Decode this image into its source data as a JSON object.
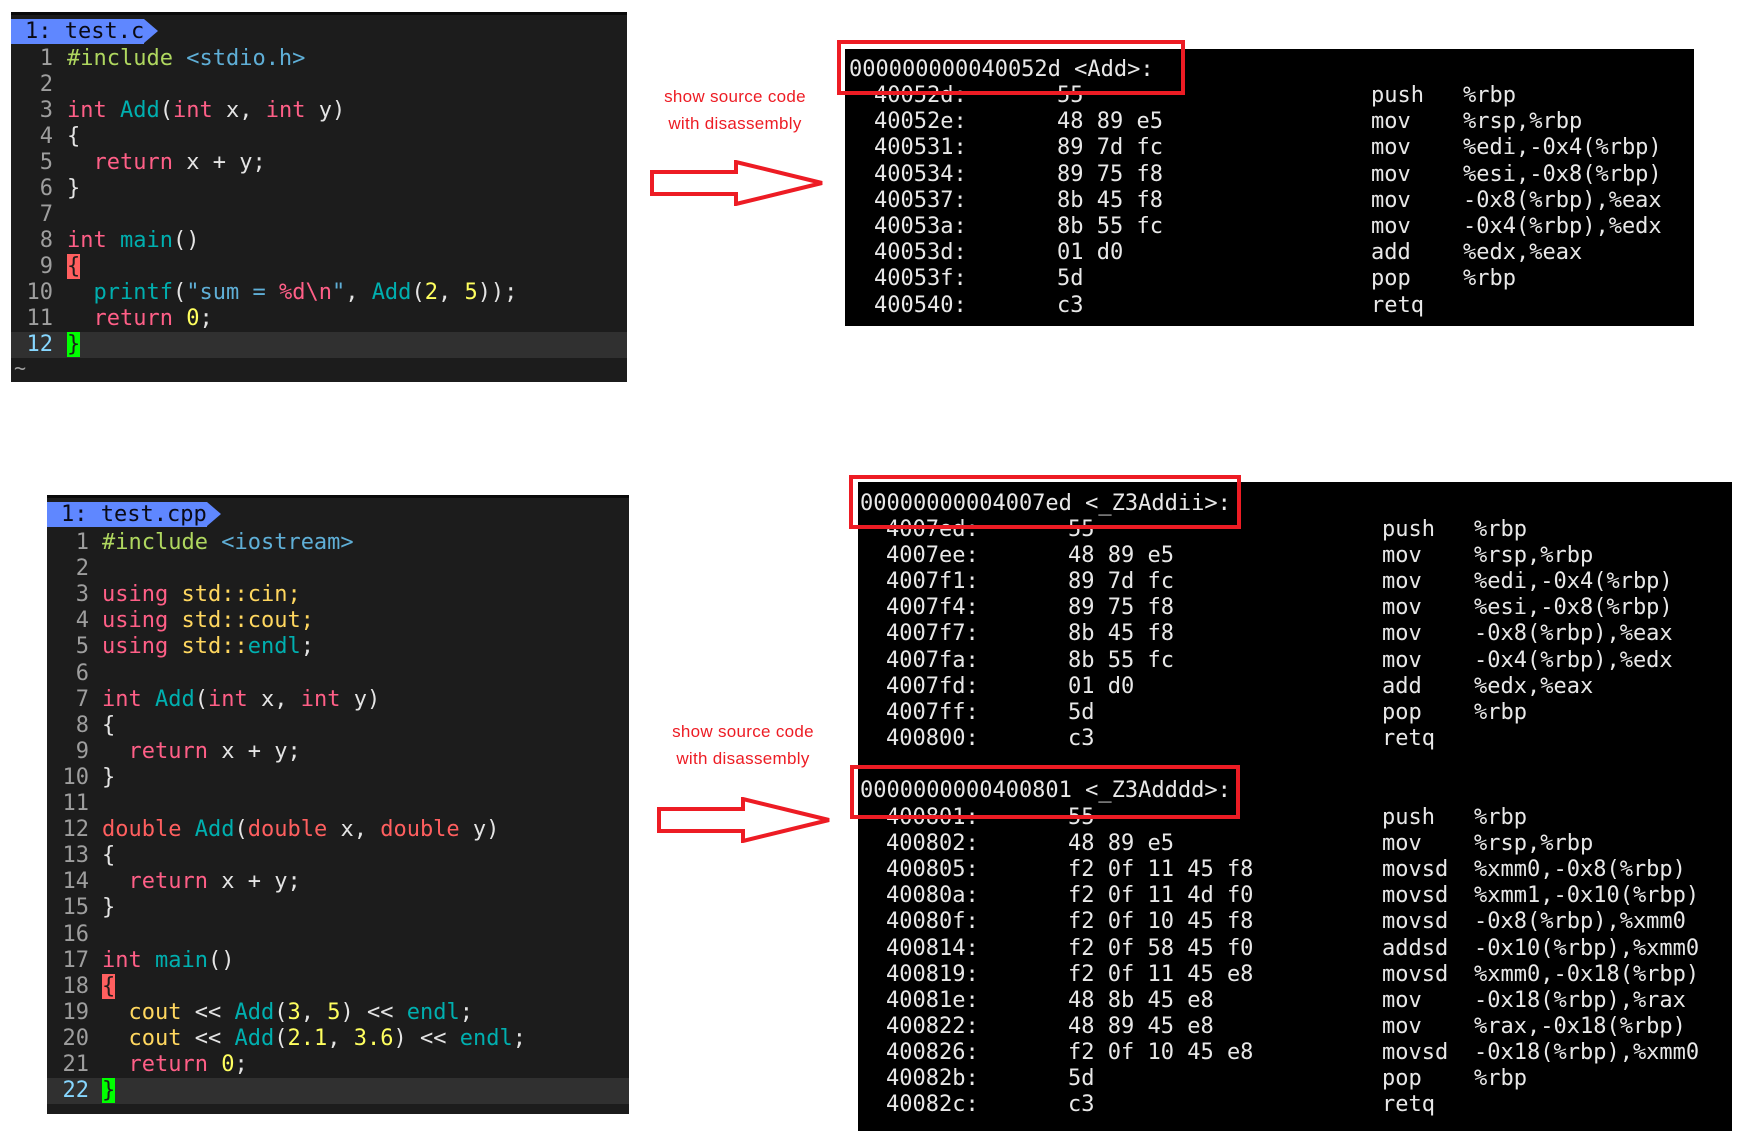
{
  "colors": {
    "accent_red": "#ed1c24",
    "tab_blue": "#5f87ff",
    "editor_bg": "#1c1c1c",
    "terminal_bg": "#000000"
  },
  "editors": [
    {
      "tab": "1: test.c",
      "tilde": "~",
      "lines": [
        {
          "num": "1",
          "tokens": [
            {
              "t": "#include ",
              "c": "pre"
            },
            {
              "t": "<stdio.h>",
              "c": "inc"
            }
          ]
        },
        {
          "num": "2",
          "tokens": []
        },
        {
          "num": "3",
          "tokens": [
            {
              "t": "int",
              "c": "kw"
            },
            {
              "t": " ",
              "c": "pl"
            },
            {
              "t": "Add",
              "c": "fn"
            },
            {
              "t": "(",
              "c": "pl"
            },
            {
              "t": "int",
              "c": "kw"
            },
            {
              "t": " x, ",
              "c": "pl"
            },
            {
              "t": "int",
              "c": "kw"
            },
            {
              "t": " y)",
              "c": "pl"
            }
          ]
        },
        {
          "num": "4",
          "tokens": [
            {
              "t": "{",
              "c": "pl"
            }
          ]
        },
        {
          "num": "5",
          "tokens": [
            {
              "t": "  ",
              "c": "pl"
            },
            {
              "t": "return",
              "c": "kw"
            },
            {
              "t": " x + y;",
              "c": "pl"
            }
          ]
        },
        {
          "num": "6",
          "tokens": [
            {
              "t": "}",
              "c": "pl"
            }
          ]
        },
        {
          "num": "7",
          "tokens": []
        },
        {
          "num": "8",
          "tokens": [
            {
              "t": "int",
              "c": "kw"
            },
            {
              "t": " ",
              "c": "pl"
            },
            {
              "t": "main",
              "c": "fn"
            },
            {
              "t": "()",
              "c": "pl"
            }
          ]
        },
        {
          "num": "9",
          "tokens": [
            {
              "t": "{",
              "c": "bo"
            }
          ]
        },
        {
          "num": "10",
          "tokens": [
            {
              "t": "  ",
              "c": "pl"
            },
            {
              "t": "printf",
              "c": "fn"
            },
            {
              "t": "(",
              "c": "pl"
            },
            {
              "t": "\"sum = ",
              "c": "str"
            },
            {
              "t": "%d\\n",
              "c": "esc"
            },
            {
              "t": "\"",
              "c": "str"
            },
            {
              "t": ", ",
              "c": "pl"
            },
            {
              "t": "Add",
              "c": "fn"
            },
            {
              "t": "(",
              "c": "pl"
            },
            {
              "t": "2",
              "c": "num"
            },
            {
              "t": ", ",
              "c": "pl"
            },
            {
              "t": "5",
              "c": "num"
            },
            {
              "t": "));",
              "c": "pl"
            }
          ]
        },
        {
          "num": "11",
          "tokens": [
            {
              "t": "  ",
              "c": "pl"
            },
            {
              "t": "return",
              "c": "kw"
            },
            {
              "t": " ",
              "c": "pl"
            },
            {
              "t": "0",
              "c": "num"
            },
            {
              "t": ";",
              "c": "pl"
            }
          ]
        },
        {
          "num": "12",
          "current": true,
          "tokens": [
            {
              "t": "}",
              "c": "bc"
            }
          ]
        }
      ]
    },
    {
      "tab": "1: test.cpp",
      "lines": [
        {
          "num": "1",
          "tokens": [
            {
              "t": "#include ",
              "c": "pre"
            },
            {
              "t": "<iostream>",
              "c": "inc"
            }
          ]
        },
        {
          "num": "2",
          "tokens": []
        },
        {
          "num": "3",
          "tokens": [
            {
              "t": "using",
              "c": "kw"
            },
            {
              "t": " std::cin;",
              "c": "ns"
            }
          ]
        },
        {
          "num": "4",
          "tokens": [
            {
              "t": "using",
              "c": "kw"
            },
            {
              "t": " std::cout;",
              "c": "ns"
            }
          ]
        },
        {
          "num": "5",
          "tokens": [
            {
              "t": "using",
              "c": "kw"
            },
            {
              "t": " std::",
              "c": "ns"
            },
            {
              "t": "endl",
              "c": "fn"
            },
            {
              "t": ";",
              "c": "pl"
            }
          ]
        },
        {
          "num": "6",
          "tokens": []
        },
        {
          "num": "7",
          "tokens": [
            {
              "t": "int",
              "c": "kw"
            },
            {
              "t": " ",
              "c": "pl"
            },
            {
              "t": "Add",
              "c": "fn"
            },
            {
              "t": "(",
              "c": "pl"
            },
            {
              "t": "int",
              "c": "kw"
            },
            {
              "t": " x, ",
              "c": "pl"
            },
            {
              "t": "int",
              "c": "kw"
            },
            {
              "t": " y)",
              "c": "pl"
            }
          ]
        },
        {
          "num": "8",
          "tokens": [
            {
              "t": "{",
              "c": "pl"
            }
          ]
        },
        {
          "num": "9",
          "tokens": [
            {
              "t": "  ",
              "c": "pl"
            },
            {
              "t": "return",
              "c": "kw"
            },
            {
              "t": " x + y;",
              "c": "pl"
            }
          ]
        },
        {
          "num": "10",
          "tokens": [
            {
              "t": "}",
              "c": "pl"
            }
          ]
        },
        {
          "num": "11",
          "tokens": []
        },
        {
          "num": "12",
          "tokens": [
            {
              "t": "double",
              "c": "ty"
            },
            {
              "t": " ",
              "c": "pl"
            },
            {
              "t": "Add",
              "c": "fn"
            },
            {
              "t": "(",
              "c": "pl"
            },
            {
              "t": "double",
              "c": "ty"
            },
            {
              "t": " x, ",
              "c": "pl"
            },
            {
              "t": "double",
              "c": "ty"
            },
            {
              "t": " y)",
              "c": "pl"
            }
          ]
        },
        {
          "num": "13",
          "tokens": [
            {
              "t": "{",
              "c": "pl"
            }
          ]
        },
        {
          "num": "14",
          "tokens": [
            {
              "t": "  ",
              "c": "pl"
            },
            {
              "t": "return",
              "c": "kw"
            },
            {
              "t": " x + y;",
              "c": "pl"
            }
          ]
        },
        {
          "num": "15",
          "tokens": [
            {
              "t": "}",
              "c": "pl"
            }
          ]
        },
        {
          "num": "16",
          "tokens": []
        },
        {
          "num": "17",
          "tokens": [
            {
              "t": "int",
              "c": "kw"
            },
            {
              "t": " ",
              "c": "pl"
            },
            {
              "t": "main",
              "c": "fn"
            },
            {
              "t": "()",
              "c": "pl"
            }
          ]
        },
        {
          "num": "18",
          "tokens": [
            {
              "t": "{",
              "c": "bo"
            }
          ]
        },
        {
          "num": "19",
          "tokens": [
            {
              "t": "  ",
              "c": "pl"
            },
            {
              "t": "cout",
              "c": "ns"
            },
            {
              "t": " << ",
              "c": "pl"
            },
            {
              "t": "Add",
              "c": "fn"
            },
            {
              "t": "(",
              "c": "pl"
            },
            {
              "t": "3",
              "c": "num"
            },
            {
              "t": ", ",
              "c": "pl"
            },
            {
              "t": "5",
              "c": "num"
            },
            {
              "t": ") << ",
              "c": "pl"
            },
            {
              "t": "endl",
              "c": "fn"
            },
            {
              "t": ";",
              "c": "pl"
            }
          ]
        },
        {
          "num": "20",
          "tokens": [
            {
              "t": "  ",
              "c": "pl"
            },
            {
              "t": "cout",
              "c": "ns"
            },
            {
              "t": " << ",
              "c": "pl"
            },
            {
              "t": "Add",
              "c": "fn"
            },
            {
              "t": "(",
              "c": "pl"
            },
            {
              "t": "2.1",
              "c": "num"
            },
            {
              "t": ", ",
              "c": "pl"
            },
            {
              "t": "3.6",
              "c": "num"
            },
            {
              "t": ") << ",
              "c": "pl"
            },
            {
              "t": "endl",
              "c": "fn"
            },
            {
              "t": ";",
              "c": "pl"
            }
          ]
        },
        {
          "num": "21",
          "tokens": [
            {
              "t": "  ",
              "c": "pl"
            },
            {
              "t": "return",
              "c": "kw"
            },
            {
              "t": " ",
              "c": "pl"
            },
            {
              "t": "0",
              "c": "num"
            },
            {
              "t": ";",
              "c": "pl"
            }
          ]
        },
        {
          "num": "22",
          "current": true,
          "tokens": [
            {
              "t": "}",
              "c": "bc"
            }
          ]
        }
      ]
    }
  ],
  "annotations": [
    {
      "line1": "show source code",
      "line2": "with disassembly"
    },
    {
      "line1": "show source code",
      "line2": "with disassembly"
    }
  ],
  "disassembly": [
    {
      "functions": [
        {
          "header": "000000000040052d <Add>:",
          "rows": [
            [
              "40052d:",
              "55",
              "push",
              "%rbp"
            ],
            [
              "40052e:",
              "48 89 e5",
              "mov",
              "%rsp,%rbp"
            ],
            [
              "400531:",
              "89 7d fc",
              "mov",
              "%edi,-0x4(%rbp)"
            ],
            [
              "400534:",
              "89 75 f8",
              "mov",
              "%esi,-0x8(%rbp)"
            ],
            [
              "400537:",
              "8b 45 f8",
              "mov",
              "-0x8(%rbp),%eax"
            ],
            [
              "40053a:",
              "8b 55 fc",
              "mov",
              "-0x4(%rbp),%edx"
            ],
            [
              "40053d:",
              "01 d0",
              "add",
              "%edx,%eax"
            ],
            [
              "40053f:",
              "5d",
              "pop",
              "%rbp"
            ],
            [
              "400540:",
              "c3",
              "retq",
              ""
            ]
          ]
        }
      ]
    },
    {
      "functions": [
        {
          "header": "00000000004007ed <_Z3Addii>:",
          "rows": [
            [
              "4007ed:",
              "55",
              "push",
              "%rbp"
            ],
            [
              "4007ee:",
              "48 89 e5",
              "mov",
              "%rsp,%rbp"
            ],
            [
              "4007f1:",
              "89 7d fc",
              "mov",
              "%edi,-0x4(%rbp)"
            ],
            [
              "4007f4:",
              "89 75 f8",
              "mov",
              "%esi,-0x8(%rbp)"
            ],
            [
              "4007f7:",
              "8b 45 f8",
              "mov",
              "-0x8(%rbp),%eax"
            ],
            [
              "4007fa:",
              "8b 55 fc",
              "mov",
              "-0x4(%rbp),%edx"
            ],
            [
              "4007fd:",
              "01 d0",
              "add",
              "%edx,%eax"
            ],
            [
              "4007ff:",
              "5d",
              "pop",
              "%rbp"
            ],
            [
              "400800:",
              "c3",
              "retq",
              ""
            ]
          ]
        },
        {
          "header": "0000000000400801 <_Z3Adddd>:",
          "rows": [
            [
              "400801:",
              "55",
              "push",
              "%rbp"
            ],
            [
              "400802:",
              "48 89 e5",
              "mov",
              "%rsp,%rbp"
            ],
            [
              "400805:",
              "f2 0f 11 45 f8",
              "movsd",
              "%xmm0,-0x8(%rbp)"
            ],
            [
              "40080a:",
              "f2 0f 11 4d f0",
              "movsd",
              "%xmm1,-0x10(%rbp)"
            ],
            [
              "40080f:",
              "f2 0f 10 45 f8",
              "movsd",
              "-0x8(%rbp),%xmm0"
            ],
            [
              "400814:",
              "f2 0f 58 45 f0",
              "addsd",
              "-0x10(%rbp),%xmm0"
            ],
            [
              "400819:",
              "f2 0f 11 45 e8",
              "movsd",
              "%xmm0,-0x18(%rbp)"
            ],
            [
              "40081e:",
              "48 8b 45 e8",
              "mov",
              "-0x18(%rbp),%rax"
            ],
            [
              "400822:",
              "48 89 45 e8",
              "mov",
              "%rax,-0x18(%rbp)"
            ],
            [
              "400826:",
              "f2 0f 10 45 e8",
              "movsd",
              "-0x18(%rbp),%xmm0"
            ],
            [
              "40082b:",
              "5d",
              "pop",
              "%rbp"
            ],
            [
              "40082c:",
              "c3",
              "retq",
              ""
            ]
          ]
        }
      ]
    }
  ]
}
